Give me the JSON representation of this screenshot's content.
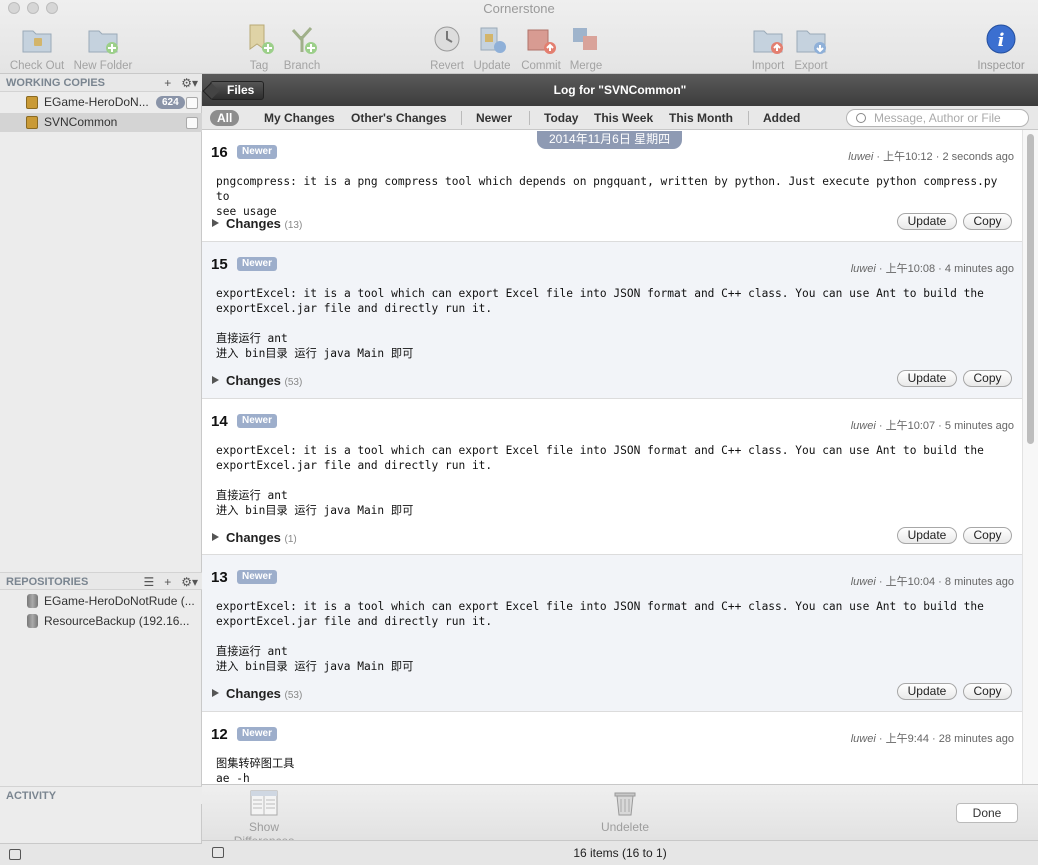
{
  "window": {
    "title": "Cornerstone"
  },
  "toolbar": {
    "check_out": "Check Out",
    "new_folder": "New Folder",
    "tag": "Tag",
    "branch": "Branch",
    "revert": "Revert",
    "update": "Update",
    "commit": "Commit",
    "merge": "Merge",
    "import": "Import",
    "export": "Export",
    "inspector": "Inspector"
  },
  "sidebar": {
    "working_copies_header": "WORKING COPIES",
    "working_copies": [
      {
        "name": "EGame-HeroDoN...",
        "badge": "624"
      },
      {
        "name": "SVNCommon"
      }
    ],
    "repositories_header": "REPOSITORIES",
    "repositories": [
      {
        "name": "EGame-HeroDoNotRude (..."
      },
      {
        "name": "ResourceBackup (192.16..."
      }
    ],
    "activity_header": "ACTIVITY"
  },
  "log": {
    "back_label": "Files",
    "title": "Log for \"SVNCommon\"",
    "filters": [
      "All",
      "My Changes",
      "Other's Changes",
      "Newer",
      "Today",
      "This Week",
      "This Month",
      "Added"
    ],
    "search_placeholder": "Message, Author or File",
    "date_header": "2014年11月6日 星期四",
    "update_label": "Update",
    "copy_label": "Copy",
    "changes_label": "Changes",
    "newer_label": "Newer",
    "entries": [
      {
        "rev": "16",
        "author": "luwei",
        "time": "上午10:12 · 2 seconds ago",
        "message": "pngcompress: it is a png compress tool which depends on pngquant, written by python. Just execute python compress.py to\nsee usage",
        "count": "(13)"
      },
      {
        "rev": "15",
        "author": "luwei",
        "time": "上午10:08 · 4 minutes ago",
        "message": "exportExcel: it is a tool which can export Excel file into JSON format and C++ class. You can use Ant to build the\nexportExcel.jar file and directly run it.\n\n直接运行 ant\n进入 bin目录 运行 java Main 即可",
        "count": "(53)"
      },
      {
        "rev": "14",
        "author": "luwei",
        "time": "上午10:07 · 5 minutes ago",
        "message": "exportExcel: it is a tool which can export Excel file into JSON format and C++ class. You can use Ant to build the\nexportExcel.jar file and directly run it.\n\n直接运行 ant\n进入 bin目录 运行 java Main 即可",
        "count": "(1)"
      },
      {
        "rev": "13",
        "author": "luwei",
        "time": "上午10:04 · 8 minutes ago",
        "message": "exportExcel: it is a tool which can export Excel file into JSON format and C++ class. You can use Ant to build the\nexportExcel.jar file and directly run it.\n\n直接运行 ant\n进入 bin目录 运行 java Main 即可",
        "count": "(53)"
      },
      {
        "rev": "12",
        "author": "luwei",
        "time": "上午9:44 · 28 minutes ago",
        "message": "图集转碎图工具\nae -h",
        "count": ""
      }
    ]
  },
  "bottom": {
    "show_differences": "Show Differences",
    "undelete": "Undelete",
    "done": "Done",
    "status": "16 items (16 to 1)"
  }
}
